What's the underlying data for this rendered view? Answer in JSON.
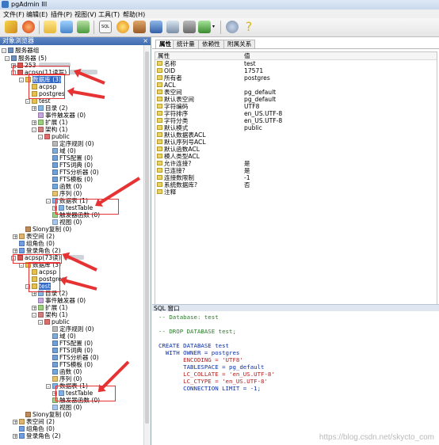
{
  "window": {
    "title": "pgAdmin III"
  },
  "menu": [
    "文件(F)",
    "编辑(E)",
    "插件(P)",
    "视图(V)",
    "工具(T)",
    "帮助(H)"
  ],
  "colors": {
    "accent": "#3168c5",
    "annotation_red": "#e63232"
  },
  "browser": {
    "title": "对象浏览器",
    "close": "×",
    "items": [
      {
        "label": "服务器组",
        "expander": "-",
        "icon": "server-group-icon"
      },
      {
        "label": "服务器 (5)",
        "expander": "-",
        "icon": "servers-icon"
      },
      {
        "label": "253",
        "expander": "+",
        "icon": "server-icon"
      },
      {
        "label": "acpsp(11读写)",
        "expander": "-",
        "icon": "server-icon"
      },
      {
        "label": "数据库 (3)",
        "expander": "-",
        "icon": "databases-icon"
      },
      {
        "label": "acpsp",
        "expander": "",
        "icon": "database-icon"
      },
      {
        "label": "postgres",
        "expander": "",
        "icon": "database-icon"
      },
      {
        "label": "test",
        "expander": "-",
        "icon": "database-icon"
      },
      {
        "label": "目录 (2)",
        "expander": "+",
        "icon": "catalogs-icon"
      },
      {
        "label": "事件触发器 (0)",
        "expander": "",
        "icon": "event-trigger-icon"
      },
      {
        "label": "扩展 (1)",
        "expander": "+",
        "icon": "extensions-icon"
      },
      {
        "label": "架构 (1)",
        "expander": "-",
        "icon": "schemas-icon"
      },
      {
        "label": "public",
        "expander": "-",
        "icon": "schema-icon"
      },
      {
        "label": "定序规则 (0)",
        "expander": "",
        "icon": "collation-icon"
      },
      {
        "label": "域 (0)",
        "expander": "",
        "icon": "domain-icon"
      },
      {
        "label": "FTS配置 (0)",
        "expander": "",
        "icon": "fts-icon"
      },
      {
        "label": "FTS词典 (0)",
        "expander": "",
        "icon": "fts-icon"
      },
      {
        "label": "FTS分析器 (0)",
        "expander": "",
        "icon": "fts-icon"
      },
      {
        "label": "FTS模板 (0)",
        "expander": "",
        "icon": "fts-icon"
      },
      {
        "label": "函数 (0)",
        "expander": "",
        "icon": "function-icon"
      },
      {
        "label": "序列 (0)",
        "expander": "",
        "icon": "sequence-icon"
      },
      {
        "label": "数据表 (1)",
        "expander": "-",
        "icon": "tables-icon"
      },
      {
        "label": "testTable",
        "expander": "+",
        "icon": "table-icon"
      },
      {
        "label": "触发器函数 (0)",
        "expander": "",
        "icon": "trigger-function-icon"
      },
      {
        "label": "视图 (0)",
        "expander": "",
        "icon": "view-icon"
      },
      {
        "label": "Slony复制 (0)",
        "expander": "",
        "icon": "slony-icon"
      },
      {
        "label": "表空间 (2)",
        "expander": "+",
        "icon": "tablespaces-icon"
      },
      {
        "label": "组角色 (0)",
        "expander": "",
        "icon": "group-roles-icon"
      },
      {
        "label": "登录角色 (2)",
        "expander": "+",
        "icon": "login-roles-icon"
      },
      {
        "label": "acpsp(73读)",
        "expander": "-",
        "icon": "server-icon"
      },
      {
        "label": "数据库 (3)",
        "expander": "-",
        "icon": "databases-icon"
      },
      {
        "label": "acpsp",
        "expander": "",
        "icon": "database-icon"
      },
      {
        "label": "postgres",
        "expander": "",
        "icon": "database-icon"
      },
      {
        "label": "test",
        "expander": "-",
        "icon": "database-icon"
      },
      {
        "label": "目录 (2)",
        "expander": "+",
        "icon": "catalogs-icon"
      },
      {
        "label": "事件触发器 (0)",
        "expander": "",
        "icon": "event-trigger-icon"
      },
      {
        "label": "扩展 (1)",
        "expander": "+",
        "icon": "extensions-icon"
      },
      {
        "label": "架构 (1)",
        "expander": "-",
        "icon": "schemas-icon"
      },
      {
        "label": "public",
        "expander": "-",
        "icon": "schema-icon"
      },
      {
        "label": "定序规则 (0)",
        "expander": "",
        "icon": "collation-icon"
      },
      {
        "label": "域 (0)",
        "expander": "",
        "icon": "domain-icon"
      },
      {
        "label": "FTS配置 (0)",
        "expander": "",
        "icon": "fts-icon"
      },
      {
        "label": "FTS词典 (0)",
        "expander": "",
        "icon": "fts-icon"
      },
      {
        "label": "FTS分析器 (0)",
        "expander": "",
        "icon": "fts-icon"
      },
      {
        "label": "FTS模板 (0)",
        "expander": "",
        "icon": "fts-icon"
      },
      {
        "label": "函数 (0)",
        "expander": "",
        "icon": "function-icon"
      },
      {
        "label": "序列 (0)",
        "expander": "",
        "icon": "sequence-icon"
      },
      {
        "label": "数据表 (1)",
        "expander": "-",
        "icon": "tables-icon"
      },
      {
        "label": "testTable",
        "expander": "+",
        "icon": "table-icon"
      },
      {
        "label": "触发器函数 (0)",
        "expander": "",
        "icon": "trigger-function-icon"
      },
      {
        "label": "视图 (0)",
        "expander": "",
        "icon": "view-icon"
      },
      {
        "label": "Slony复制 (0)",
        "expander": "",
        "icon": "slony-icon"
      },
      {
        "label": "表空间 (2)",
        "expander": "+",
        "icon": "tablespaces-icon"
      },
      {
        "label": "组角色 (0)",
        "expander": "",
        "icon": "group-roles-icon"
      },
      {
        "label": "登录角色 (2)",
        "expander": "+",
        "icon": "login-roles-icon"
      }
    ]
  },
  "properties": {
    "tabs": [
      "属性",
      "统计量",
      "依赖性",
      "附属关系"
    ],
    "active_tab": "属性",
    "col_property": "属性",
    "col_value": "值",
    "rows": [
      {
        "name": "名称",
        "value": "test"
      },
      {
        "name": "OID",
        "value": "17571"
      },
      {
        "name": "所有者",
        "value": "postgres"
      },
      {
        "name": "ACL",
        "value": ""
      },
      {
        "name": "表空间",
        "value": "pg_default"
      },
      {
        "name": "默认表空间",
        "value": "pg_default"
      },
      {
        "name": "字符编码",
        "value": "UTF8"
      },
      {
        "name": "字符排序",
        "value": "en_US.UTF-8"
      },
      {
        "name": "字符分类",
        "value": "en_US.UTF-8"
      },
      {
        "name": "默认模式",
        "value": "public"
      },
      {
        "name": "默认数据表ACL",
        "value": ""
      },
      {
        "name": "默认序列号ACL",
        "value": ""
      },
      {
        "name": "默认函数ACL",
        "value": ""
      },
      {
        "name": "模人类型ACL",
        "value": ""
      },
      {
        "name": "允许连接?",
        "value": "是"
      },
      {
        "name": "已连接?",
        "value": "是"
      },
      {
        "name": "连接数限制",
        "value": "-1"
      },
      {
        "name": "系统数据库?",
        "value": "否"
      },
      {
        "name": "注释",
        "value": ""
      }
    ]
  },
  "sql_pane": {
    "title": "SQL 窗口",
    "lines": [
      "-- Database: test",
      "",
      "-- DROP DATABASE test;",
      "",
      "CREATE DATABASE test",
      "  WITH OWNER = postgres",
      "       ENCODING = 'UTF8'",
      "       TABLESPACE = pg_default",
      "       LC_COLLATE = 'en_US.UTF-8'",
      "       LC_CTYPE = 'en_US.UTF-8'",
      "       CONNECTION LIMIT = -1;"
    ]
  },
  "watermark": "https://blog.csdn.net/skycto_com"
}
